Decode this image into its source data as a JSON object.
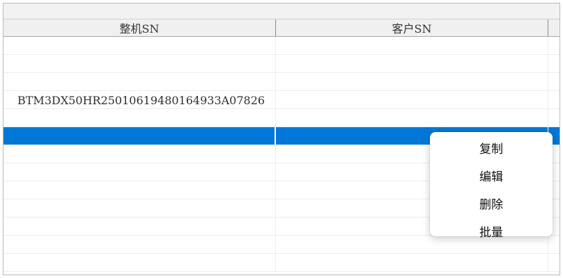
{
  "table": {
    "columns": [
      "整机SN",
      "客户SN"
    ],
    "rows": [
      {
        "sn": "",
        "customer_sn": ""
      },
      {
        "sn": "",
        "customer_sn": ""
      },
      {
        "sn": "",
        "customer_sn": ""
      },
      {
        "sn": "BTM3DX50HR25010619480164933A07826",
        "customer_sn": ""
      },
      {
        "sn": "",
        "customer_sn": ""
      },
      {
        "sn": "",
        "customer_sn": ""
      },
      {
        "sn": "",
        "customer_sn": ""
      },
      {
        "sn": "",
        "customer_sn": ""
      },
      {
        "sn": "",
        "customer_sn": ""
      },
      {
        "sn": "",
        "customer_sn": ""
      },
      {
        "sn": "",
        "customer_sn": ""
      },
      {
        "sn": "",
        "customer_sn": ""
      },
      {
        "sn": "",
        "customer_sn": ""
      }
    ],
    "selected_row": 5,
    "selection_color": "#0078d7"
  },
  "context_menu": {
    "items": [
      "复制",
      "编辑",
      "删除",
      "批量"
    ]
  }
}
